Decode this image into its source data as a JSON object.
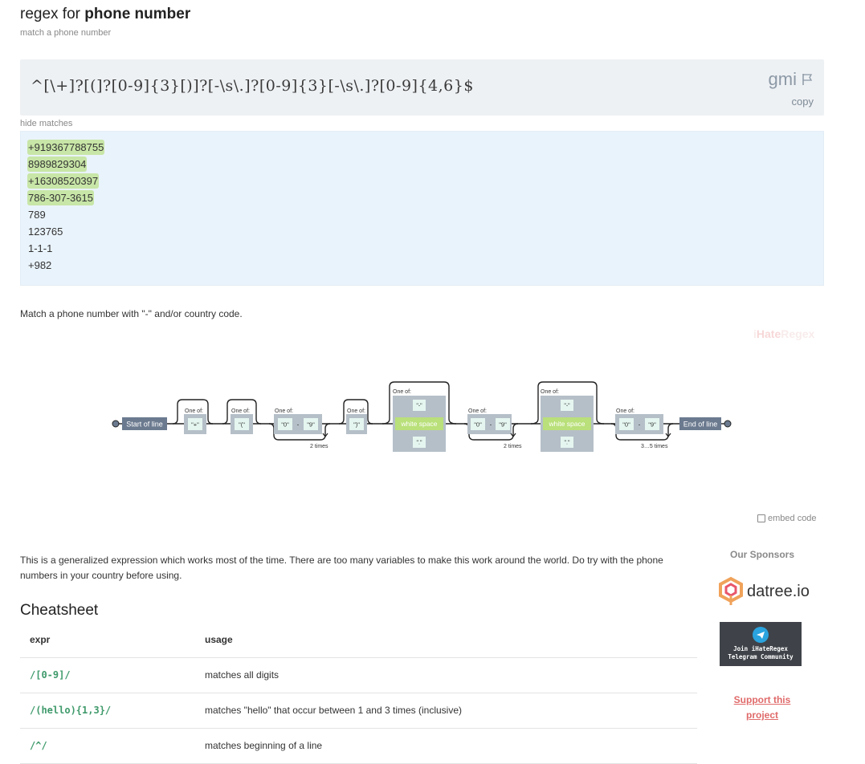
{
  "header": {
    "title_prefix": "regex for ",
    "title_bold": "phone number",
    "subtitle": "match a phone number"
  },
  "regex": {
    "pattern": "^[\\+]?[(]?[0-9]{3}[)]?[-\\s\\.]?[0-9]{3}[-\\s\\.]?[0-9]{4,6}$",
    "flags": "gmi",
    "copy_label": "copy",
    "flag_icon": "flag-icon"
  },
  "hide_matches_label": "hide matches",
  "test_strings": [
    {
      "text": "+919367788755",
      "match": true
    },
    {
      "text": "8989829304",
      "match": true
    },
    {
      "text": "+16308520397",
      "match": true
    },
    {
      "text": "786-307-3615",
      "match": true
    },
    {
      "text": "789",
      "match": false
    },
    {
      "text": "123765",
      "match": false
    },
    {
      "text": "1-1-1",
      "match": false
    },
    {
      "text": "+982",
      "match": false
    }
  ],
  "description": "Match a phone number with \"-\" and/or country code.",
  "watermark": {
    "part1": "i",
    "part2": "Hate",
    "part3": "Regex"
  },
  "diagram": {
    "start_label": "Start of line",
    "end_label": "End of line",
    "one_of": "One of:",
    "plus": "\"+\"",
    "open_paren": "\"(\"",
    "close_paren": "\")\"",
    "zero": "\"0\"",
    "nine": "\"9\"",
    "dash": "-",
    "white_space": "white space",
    "hyphen_opt": "\"-\"",
    "dot_opt": "\".\"",
    "two_times": "2 times",
    "three_five_times": "3…5 times"
  },
  "embed_label": "embed code",
  "explanation": "This is a generalized expression which works most of the time. There are too many variables to make this work around the world. Do try with the phone numbers in your country before using.",
  "cheatsheet": {
    "title": "Cheatsheet",
    "headers": [
      "expr",
      "usage"
    ],
    "rows": [
      {
        "expr": "/[0-9]/",
        "usage": "matches all digits"
      },
      {
        "expr": "/(hello){1,3}/",
        "usage": "matches \"hello\" that occur between 1 and 3 times (inclusive)"
      },
      {
        "expr": "/^/",
        "usage": "matches beginning of a line"
      }
    ]
  },
  "sponsors": {
    "title": "Our Sponsors",
    "datree": "datree.io",
    "telegram_line1": "Join iHateRegex",
    "telegram_line2": "Telegram Community",
    "support": "Support this project"
  },
  "colors": {
    "match_highlight": "#c8e6a7",
    "test_bg": "#e9f3fb",
    "regex_bg": "#eef1f4",
    "expr_green": "#3f9a6b",
    "support_red": "#e06a6a",
    "diagram_terminal": "#6b7a8f",
    "diagram_ws": "#b9e07a"
  }
}
